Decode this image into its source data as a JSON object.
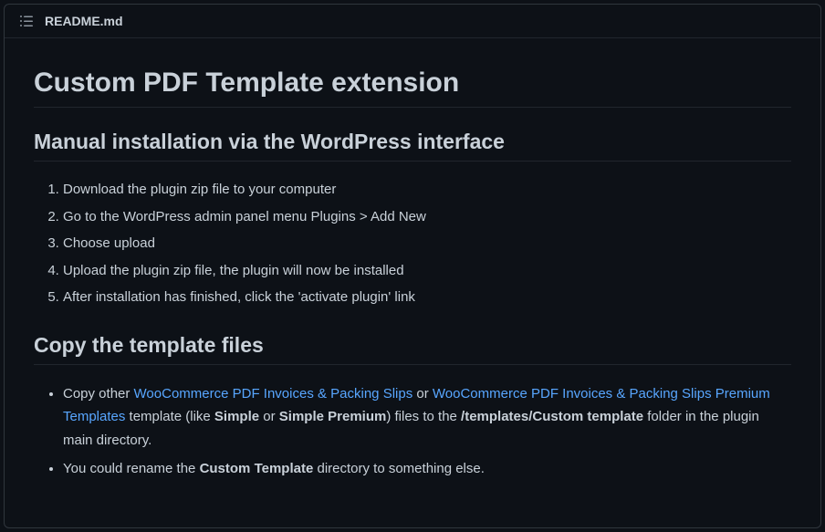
{
  "header": {
    "filename": "README.md"
  },
  "h1": "Custom PDF Template extension",
  "h2_install": "Manual installation via the WordPress interface",
  "steps": {
    "s1": "Download the plugin zip file to your computer",
    "s2": "Go to the WordPress admin panel menu Plugins > Add New",
    "s3": "Choose upload",
    "s4": "Upload the plugin zip file, the plugin will now be installed",
    "s5": "After installation has finished, click the 'activate plugin' link"
  },
  "h2_copy": "Copy the template files",
  "copy": {
    "li1_a": "Copy other ",
    "li1_link1": "WooCommerce PDF Invoices & Packing Slips",
    "li1_b": " or ",
    "li1_link2": "WooCommerce PDF Invoices & Packing Slips Premium Templates",
    "li1_c": " template (like ",
    "li1_strong1": "Simple",
    "li1_d": " or ",
    "li1_strong2": "Simple Premium",
    "li1_e": ") files to the ",
    "li1_strong3": "/templates/Custom template",
    "li1_f": " folder in the plugin main directory.",
    "li2_a": "You could rename the ",
    "li2_strong": "Custom Template",
    "li2_b": " directory to something else."
  }
}
